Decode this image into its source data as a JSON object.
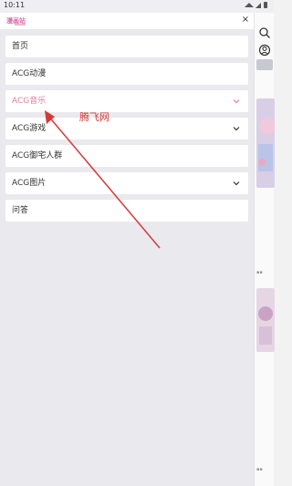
{
  "status_bar": {
    "time": "10:11",
    "icons": [
      "wifi-icon",
      "signal-icon",
      "battery-icon"
    ]
  },
  "drawer": {
    "logo_text": "漫画 站",
    "close_symbol": "×",
    "items": [
      {
        "label": "首页",
        "has_chevron": false,
        "active": false
      },
      {
        "label": "ACG动漫",
        "has_chevron": false,
        "active": false
      },
      {
        "label": "ACG音乐",
        "has_chevron": true,
        "active": true
      },
      {
        "label": "ACG游戏",
        "has_chevron": true,
        "active": false
      },
      {
        "label": "ACG御宅人群",
        "has_chevron": false,
        "active": false
      },
      {
        "label": "ACG图片",
        "has_chevron": true,
        "active": false
      },
      {
        "label": "问答",
        "has_chevron": false,
        "active": false
      }
    ]
  },
  "annotation": {
    "text": "腾飞网",
    "color": "#d33a3a"
  },
  "colors": {
    "accent_pink": "#e27d9e",
    "drawer_bg": "#e9e9ee"
  }
}
